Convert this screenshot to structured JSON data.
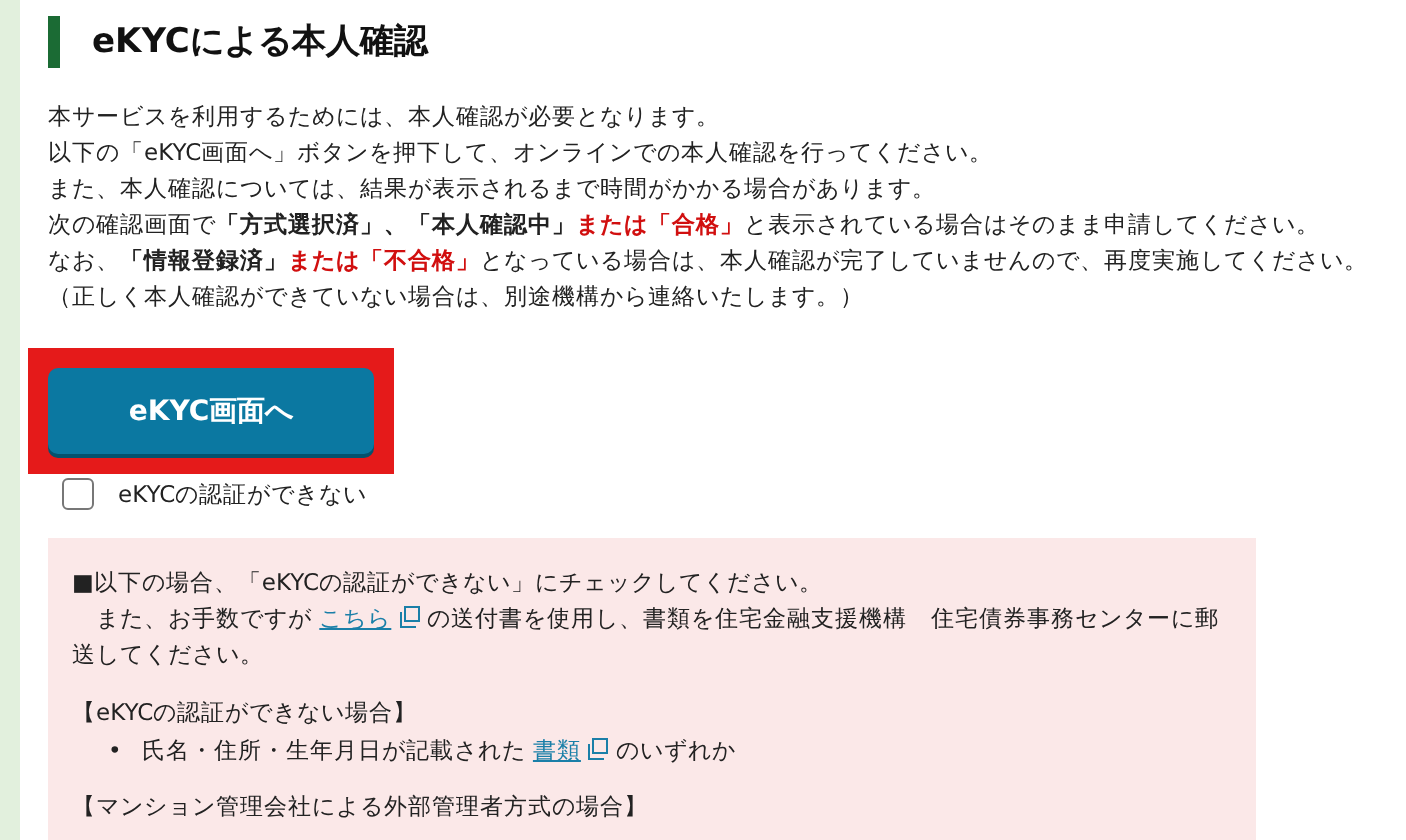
{
  "heading": "eKYCによる本人確認",
  "intro": [
    [
      {
        "kind": "plain",
        "text": "本サービスを利用するためには、本人確認が必要となります。"
      }
    ],
    [
      {
        "kind": "plain",
        "text": "以下の「eKYC画面へ」ボタンを押下して、オンラインでの本人確認を行ってください。"
      }
    ],
    [
      {
        "kind": "plain",
        "text": "また、本人確認については、結果が表示されるまで時間がかかる場合があります。"
      }
    ],
    [
      {
        "kind": "plain",
        "text": "次の確認画面で"
      },
      {
        "kind": "bold",
        "text": "「方式選択済」、「本人確認中」"
      },
      {
        "kind": "red",
        "text": "または「合格」"
      },
      {
        "kind": "plain",
        "text": "と表示されている場合はそのまま申請してください。"
      }
    ],
    [
      {
        "kind": "plain",
        "text": "なお、"
      },
      {
        "kind": "bold",
        "text": "「情報登録済」"
      },
      {
        "kind": "red",
        "text": "または「不合格」"
      },
      {
        "kind": "plain",
        "text": "となっている場合は、本人確認が完了していませんので、再度実施してください。"
      }
    ],
    [
      {
        "kind": "plain",
        "text": "（正しく本人確認ができていない場合は、別途機構から連絡いたします。）"
      }
    ]
  ],
  "ekyc_button": {
    "label": "eKYC画面へ",
    "highlighted": true
  },
  "cannot_verify": {
    "label": "eKYCの認証ができない",
    "checked": false
  },
  "notice": [
    {
      "kind": "para",
      "parts": [
        {
          "kind": "plain",
          "text": "■以下の場合、「eKYCの認証ができない」にチェックしてください。"
        }
      ]
    },
    {
      "kind": "para",
      "parts": [
        {
          "kind": "plain",
          "text": "　また、お手数ですが "
        },
        {
          "kind": "link",
          "text": "こちら"
        },
        {
          "kind": "plain",
          "text": " の送付書を使用し、書類を住宅金融支援機構　住宅債券事務センターに郵送してください。"
        }
      ]
    },
    {
      "kind": "heading",
      "text": "【eKYCの認証ができない場合】"
    },
    {
      "kind": "bullets",
      "items": [
        {
          "marker": "•",
          "parts": [
            {
              "kind": "plain",
              "text": "氏名・住所・生年月日が記載された "
            },
            {
              "kind": "link",
              "text": "書類"
            },
            {
              "kind": "plain",
              "text": " のいずれか"
            }
          ]
        }
      ]
    },
    {
      "kind": "heading",
      "text": "【マンション管理会社による外部管理者方式の場合】"
    }
  ]
}
